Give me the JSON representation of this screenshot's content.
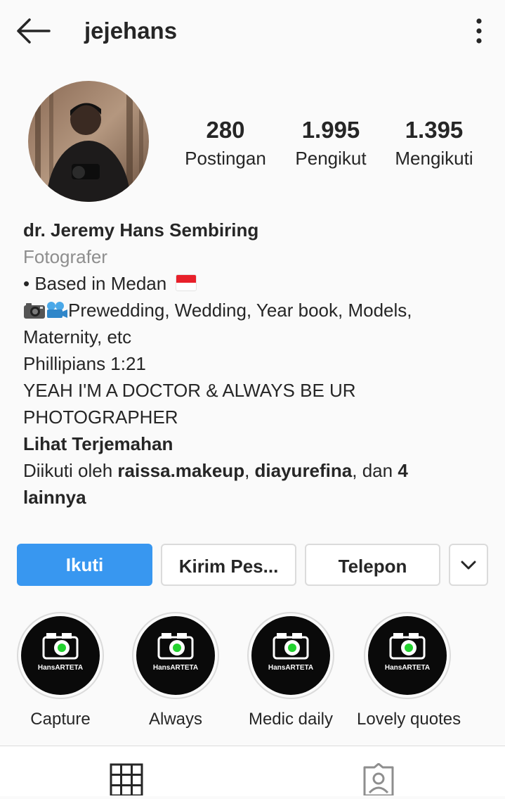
{
  "header": {
    "username": "jejehans"
  },
  "stats": [
    {
      "value": "280",
      "label": "Postingan"
    },
    {
      "value": "1.995",
      "label": "Pengikut"
    },
    {
      "value": "1.395",
      "label": "Mengikuti"
    }
  ],
  "bio": {
    "full_name": "dr. Jeremy Hans Sembiring",
    "category": "Fotografer",
    "line1": "• Based in Medan",
    "line2": "Prewedding, Wedding, Year book, Models,",
    "line3": "Maternity, etc",
    "line4": "Phillipians 1:21",
    "line5": "YEAH I'M A DOCTOR & ALWAYS BE UR",
    "line6": "PHOTOGRAPHER",
    "translate": "Lihat Terjemahan",
    "followed_prefix": "Diikuti oleh ",
    "follower1": "raissa.makeup",
    "sep": ", ",
    "follower2": "diayurefina",
    "and_text": ", dan ",
    "others_count": "4",
    "others_word": "lainnya"
  },
  "buttons": {
    "follow": "Ikuti",
    "message": "Kirim Pes...",
    "call": "Telepon"
  },
  "highlights": [
    {
      "label": "Capture",
      "logo_text": "HansARTETA"
    },
    {
      "label": "Always",
      "logo_text": "HansARTETA"
    },
    {
      "label": "Medic daily",
      "logo_text": "HansARTETA"
    },
    {
      "label": "Lovely quotes",
      "logo_text": "HansARTETA"
    }
  ],
  "colors": {
    "accent": "#3897f0",
    "text": "#262626",
    "muted": "#8e8e8e",
    "border": "#dbdbdb",
    "logo_green": "#22d22e"
  },
  "icons": [
    "back-arrow-icon",
    "more-vertical-icon",
    "chevron-down-icon",
    "grid-icon",
    "tagged-icon"
  ]
}
